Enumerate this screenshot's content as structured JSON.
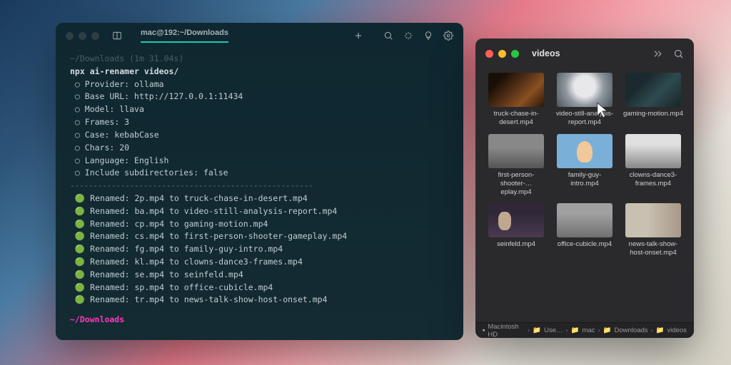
{
  "terminal": {
    "tab_title": "mac@192:~/Downloads",
    "prompt_path": "~/Downloads",
    "prompt_time": "(1m 31.04s)",
    "command": "npx ai-renamer videos/",
    "config": [
      "Provider: ollama",
      "Base URL: http://127.0.0.1:11434",
      "Model: llava",
      "Frames: 3",
      "Case: kebabCase",
      "Chars: 20",
      "Language: English",
      "Include subdirectories: false"
    ],
    "renames": [
      "Renamed: 2p.mp4 to truck-chase-in-desert.mp4",
      "Renamed: ba.mp4 to video-still-analysis-report.mp4",
      "Renamed: cp.mp4 to gaming-motion.mp4",
      "Renamed: cs.mp4 to first-person-shooter-gameplay.mp4",
      "Renamed: fg.mp4 to family-guy-intro.mp4",
      "Renamed: kl.mp4 to clowns-dance3-frames.mp4",
      "Renamed: se.mp4 to seinfeld.mp4",
      "Renamed: sp.mp4 to office-cubicle.mp4",
      "Renamed: tr.mp4 to news-talk-show-host-onset.mp4"
    ],
    "final_prompt": "~/Downloads"
  },
  "finder": {
    "title": "videos",
    "files": [
      "truck-chase-in-desert.mp4",
      "video-still-analysis-report.mp4",
      "gaming-motion.mp4",
      "first-person-shooter-…eplay.mp4",
      "family-guy-intro.mp4",
      "clowns-dance3-frames.mp4",
      "seinfeld.mp4",
      "office-cubicle.mp4",
      "news-talk-show-host-onset.mp4"
    ],
    "path": [
      "Macintosh HD",
      "Use…",
      "mac",
      "Downloads",
      "videos"
    ]
  }
}
